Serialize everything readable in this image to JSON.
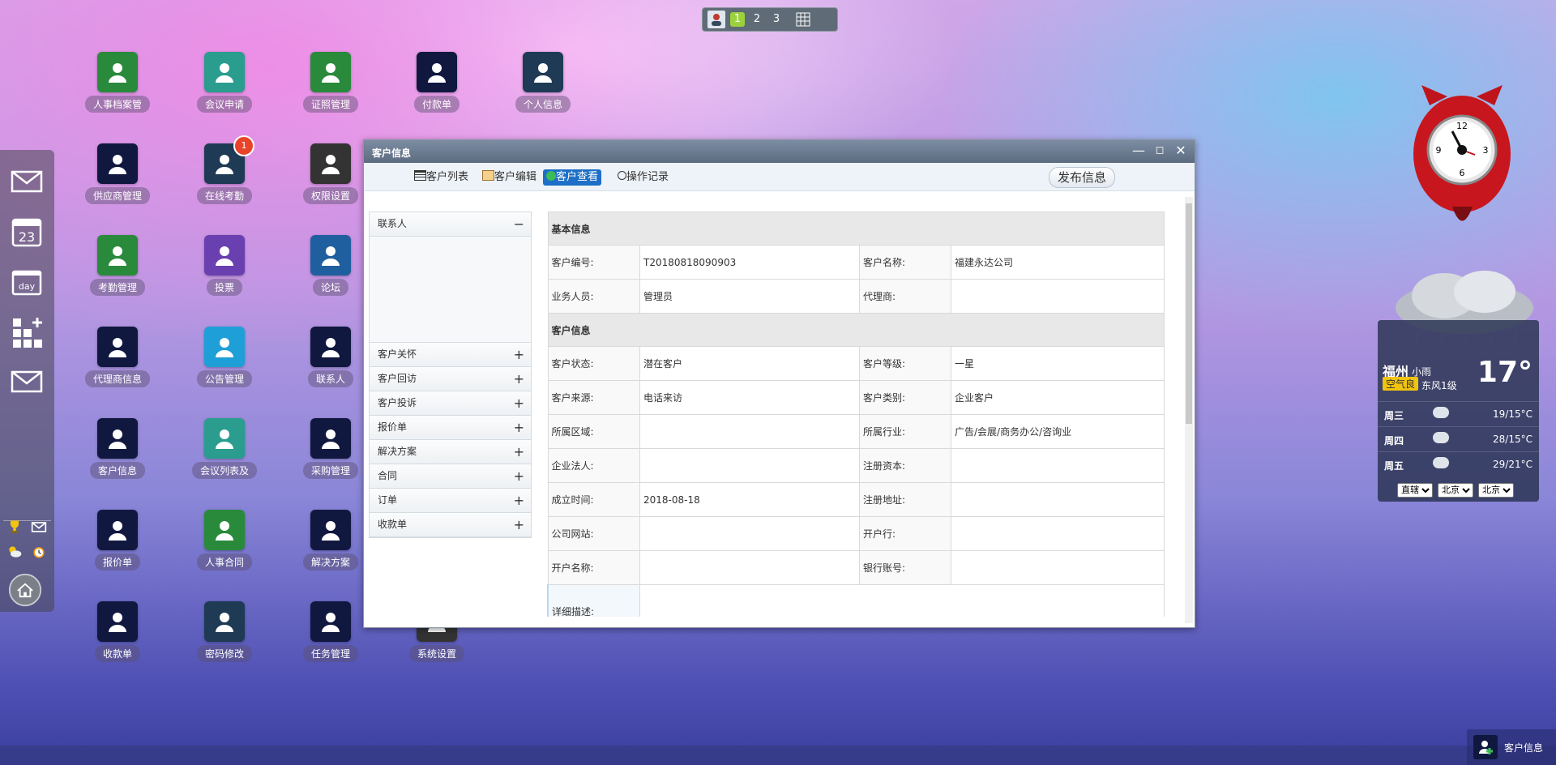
{
  "pager": {
    "pages": [
      "1",
      "2",
      "3"
    ],
    "active": "1"
  },
  "desktop_icons": [
    {
      "label": "人事档案管",
      "color": "#2a8a3c"
    },
    {
      "label": "会议申请",
      "color": "#2a9d8f"
    },
    {
      "label": "证照管理",
      "color": "#2a8a3c"
    },
    {
      "label": "付款单",
      "color": "#101840"
    },
    {
      "label": "个人信息",
      "color": "#1f3a55"
    },
    {
      "label": "供应商管理",
      "color": "#101840"
    },
    {
      "label": "在线考勤",
      "color": "#1f3a55",
      "badge": "1"
    },
    {
      "label": "权限设置",
      "color": "#333333"
    },
    {
      "label": "考勤管理",
      "color": "#2a8a3c"
    },
    {
      "label": "投票",
      "color": "#6a3fb0"
    },
    {
      "label": "论坛",
      "color": "#1f5fa0"
    },
    {
      "label": "代理商信息",
      "color": "#101840"
    },
    {
      "label": "公告管理",
      "color": "#1e9fd8"
    },
    {
      "label": "联系人",
      "color": "#101840"
    },
    {
      "label": "客户信息",
      "color": "#101840"
    },
    {
      "label": "会议列表及",
      "color": "#2a9d8f"
    },
    {
      "label": "采购管理",
      "color": "#101840"
    },
    {
      "label": "报价单",
      "color": "#101840"
    },
    {
      "label": "人事合同",
      "color": "#2a8a3c"
    },
    {
      "label": "解决方案",
      "color": "#101840"
    },
    {
      "label": "收款单",
      "color": "#101840"
    },
    {
      "label": "密码修改",
      "color": "#1f3a55"
    },
    {
      "label": "任务管理",
      "color": "#101840"
    },
    {
      "label": "系统设置",
      "color": "#333333"
    }
  ],
  "dock": {
    "calendar_day": "23",
    "day_label": "day"
  },
  "window": {
    "title": "客户信息",
    "tabs": [
      "客户列表",
      "客户编辑",
      "客户查看",
      "操作记录"
    ],
    "active_tab": "客户查看",
    "publish_button": "发布信息",
    "accordion": {
      "open": "联系人",
      "items": [
        "客户关怀",
        "客户回访",
        "客户投诉",
        "报价单",
        "解决方案",
        "合同",
        "订单",
        "收款单"
      ]
    },
    "sections": {
      "basic": "基本信息",
      "customer": "客户信息"
    },
    "fields": {
      "customer_no_label": "客户编号:",
      "customer_no": "T20180818090903",
      "customer_name_label": "客户名称:",
      "customer_name": "福建永达公司",
      "sales_label": "业务人员:",
      "sales": "管理员",
      "agent_label": "代理商:",
      "agent": "",
      "status_label": "客户状态:",
      "status": "潜在客户",
      "level_label": "客户等级:",
      "level": "一星",
      "source_label": "客户来源:",
      "source": "电话来访",
      "category_label": "客户类别:",
      "category": "企业客户",
      "region_label": "所属区域:",
      "region": "",
      "industry_label": "所属行业:",
      "industry": "广告/会展/商务办公/咨询业",
      "legal_label": "企业法人:",
      "legal": "",
      "capital_label": "注册资本:",
      "capital": "",
      "founded_label": "成立时间:",
      "founded": "2018-08-18",
      "reg_addr_label": "注册地址:",
      "reg_addr": "",
      "website_label": "公司网站:",
      "website": "",
      "bank_label": "开户行:",
      "bank": "",
      "acct_name_label": "开户名称:",
      "acct_name": "",
      "acct_no_label": "银行账号:",
      "acct_no": "",
      "desc_label": "详细描述:"
    }
  },
  "clock": {
    "n12": "12",
    "n3": "3",
    "n6": "6",
    "n9": "9"
  },
  "weather": {
    "city": "福州",
    "condition": "小雨",
    "aqi": "空气良",
    "wind": "东风1级",
    "temp": "17°",
    "forecast": [
      {
        "day": "周三",
        "range": "19/15°C"
      },
      {
        "day": "周四",
        "range": "28/15°C"
      },
      {
        "day": "周五",
        "range": "29/21°C"
      }
    ],
    "selects": [
      "直辖",
      "北京",
      "北京"
    ]
  },
  "taskbar": {
    "item": "客户信息"
  }
}
